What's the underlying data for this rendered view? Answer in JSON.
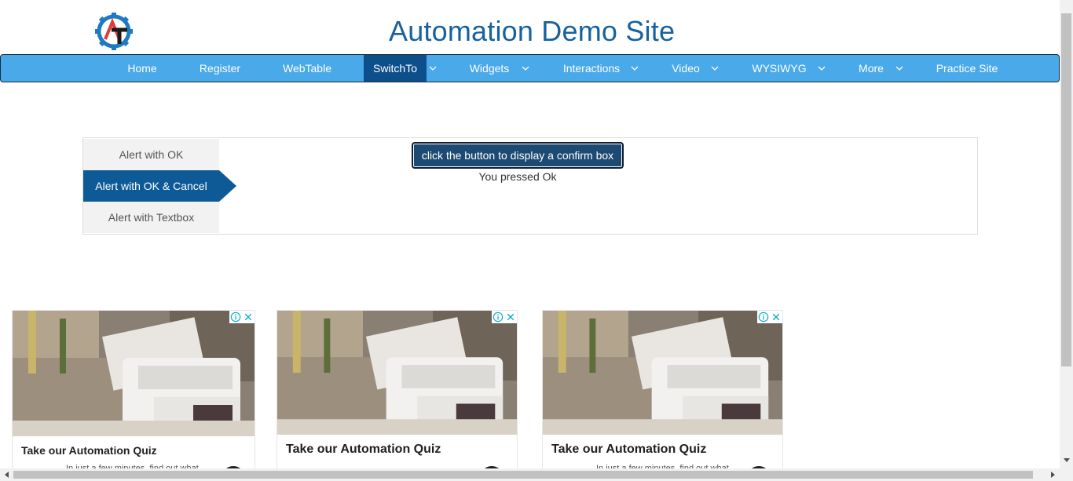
{
  "header": {
    "title": "Automation Demo Site",
    "logo_icon": "automation-gear-logo",
    "logo_colors": {
      "gear": "#1f7bc1",
      "letter_a": "#e03a3a",
      "letter_t": "#1a1a1a"
    }
  },
  "nav": {
    "items": [
      {
        "label": "Home",
        "has_dropdown": false,
        "active": false
      },
      {
        "label": "Register",
        "has_dropdown": false,
        "active": false
      },
      {
        "label": "WebTable",
        "has_dropdown": false,
        "active": false
      },
      {
        "label": "SwitchTo",
        "has_dropdown": true,
        "active": true
      },
      {
        "label": "Widgets",
        "has_dropdown": true,
        "active": false
      },
      {
        "label": "Interactions",
        "has_dropdown": true,
        "active": false
      },
      {
        "label": "Video",
        "has_dropdown": true,
        "active": false
      },
      {
        "label": "WYSIWYG",
        "has_dropdown": true,
        "active": false
      },
      {
        "label": "More",
        "has_dropdown": true,
        "active": false
      },
      {
        "label": "Practice Site",
        "has_dropdown": false,
        "active": false
      }
    ],
    "colors": {
      "bar": "#4aa9e8",
      "active": "#0d4f8a"
    }
  },
  "alerts": {
    "tabs": [
      {
        "label": "Alert with OK",
        "active": false
      },
      {
        "label": "Alert with OK & Cancel",
        "active": true
      },
      {
        "label": "Alert with Textbox",
        "active": false
      }
    ],
    "button_label": "click the button to display a confirm box",
    "result_text": "You pressed Ok"
  },
  "ads": [
    {
      "title": "Take our Automation Quiz",
      "subtitle": "In just a few minutes, find out what"
    },
    {
      "title": "Take our Automation Quiz",
      "subtitle": ""
    },
    {
      "title": "Take our Automation Quiz",
      "subtitle": "In just a few minutes, find out what"
    }
  ],
  "ad_badges": {
    "info_icon": "ad-info-icon",
    "close_icon": "ad-close-icon",
    "color": "#00aecd"
  }
}
